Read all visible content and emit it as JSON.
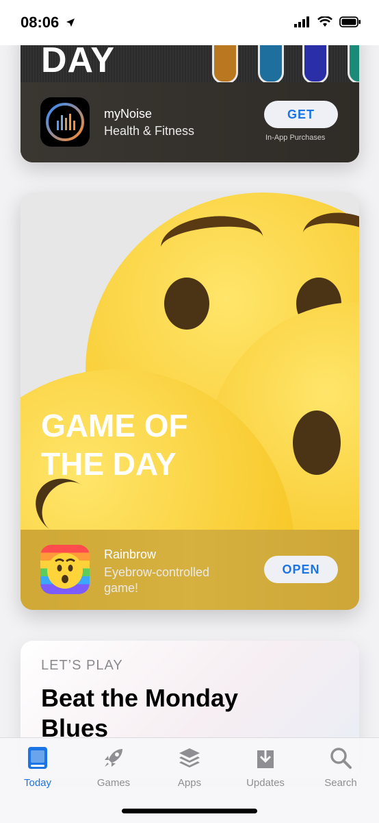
{
  "status_bar": {
    "time": "08:06"
  },
  "cards": {
    "featured_top": {
      "title": "DAY",
      "app_name": "myNoise",
      "app_subtitle": "Health & Fitness",
      "button_label": "GET",
      "iap_note": "In-App Purchases"
    },
    "game_of_the_day": {
      "title": "GAME OF THE DAY",
      "app_name": "Rainbrow",
      "app_subtitle": "Eyebrow-controlled game!",
      "button_label": "OPEN"
    },
    "lets_play": {
      "eyebrow": "LET’S PLAY",
      "title": "Beat the Monday Blues"
    }
  },
  "tabbar": {
    "tabs": [
      {
        "label": "Today",
        "icon": "today-icon",
        "active": true
      },
      {
        "label": "Games",
        "icon": "rocket-icon",
        "active": false
      },
      {
        "label": "Apps",
        "icon": "layers-icon",
        "active": false
      },
      {
        "label": "Updates",
        "icon": "download-icon",
        "active": false
      },
      {
        "label": "Search",
        "icon": "search-icon",
        "active": false
      }
    ]
  },
  "colors": {
    "accent": "#1b74e4",
    "inactive_tab": "#8e8e93"
  }
}
